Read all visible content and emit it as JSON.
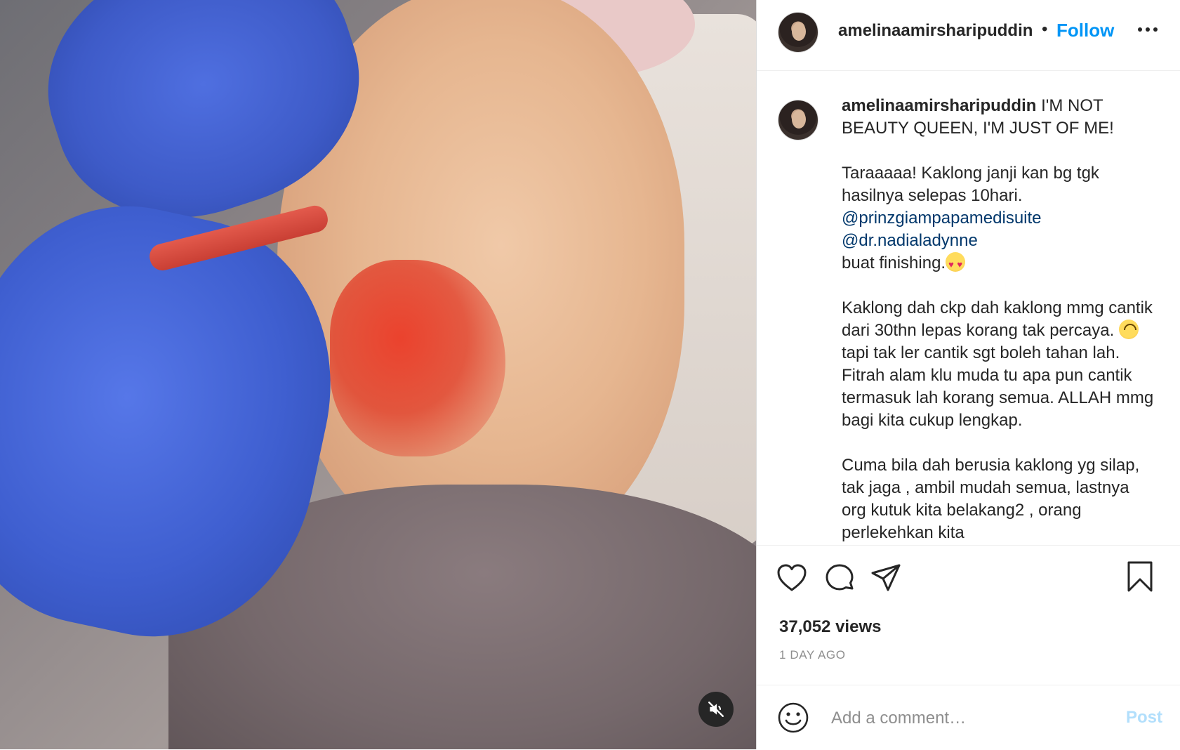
{
  "post": {
    "username": "amelinaamirsharipuddin",
    "follow_label": "Follow",
    "header_separator": "•",
    "caption": {
      "title": "I'M NOT BEAUTY QUEEN, I'M JUST OF ME!",
      "p1_line1": "Taraaaaa! Kaklong janji kan bg tgk hasilnya selepas 10hari.",
      "mention1": "@prinzgiampapamedisuite",
      "mention2": "@dr.nadialadynne",
      "p1_end": "buat finishing.",
      "p2_a": "Kaklong dah ckp dah kaklong mmg cantik dari 30thn lepas korang tak percaya. ",
      "p2_b": " tapi tak ler cantik sgt boleh tahan lah. Fitrah alam klu muda tu apa pun cantik termasuk lah korang semua. ALLAH mmg bagi kita cukup lengkap.",
      "p3": "Cuma bila dah berusia kaklong yg silap, tak jaga , ambil mudah semua, lastnya org kutuk kita belakang2 , orang perlekehkan kita",
      "emoji1": "heart-eyes-emoji",
      "emoji2": "upside-down-face-emoji"
    },
    "views": "37,052 views",
    "timestamp": "1 DAY AGO"
  },
  "comment": {
    "placeholder": "Add a comment…",
    "post_label": "Post"
  },
  "icons": {
    "more": "more-options-icon",
    "like": "heart-icon",
    "comment": "comment-icon",
    "share": "share-icon",
    "save": "bookmark-icon",
    "emoji": "smiley-icon",
    "mute": "muted-speaker-icon"
  },
  "colors": {
    "link": "#0095f6",
    "mention": "#00376b",
    "post_disabled": "#b2dffc",
    "secondary_text": "#8e8e8e",
    "glove_blue": "#3e5bc8",
    "gel_red": "#e03a28"
  }
}
